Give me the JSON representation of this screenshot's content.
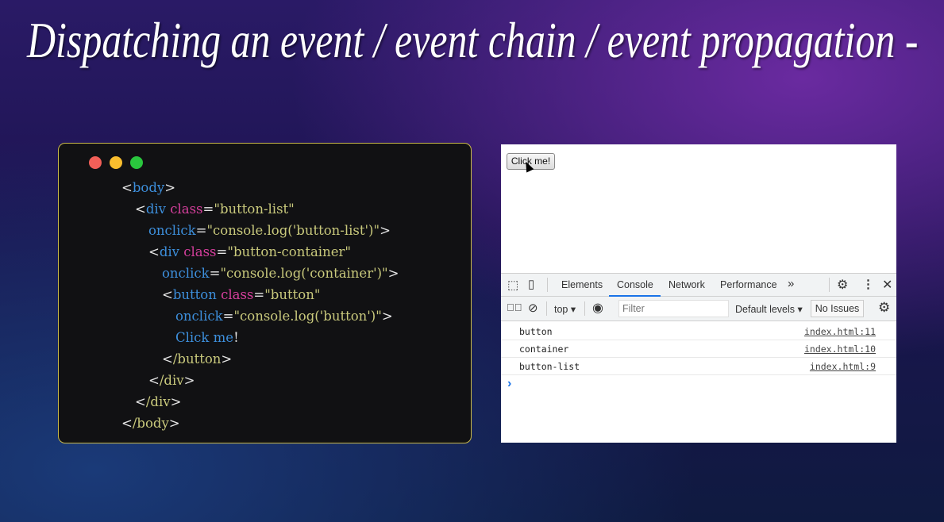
{
  "title": "Dispatching an event / event chain / event propagation -",
  "code": {
    "lines": [
      {
        "indent": 0,
        "tokens": [
          [
            "<",
            "p"
          ],
          [
            "body",
            "tag"
          ],
          [
            ">",
            "p"
          ]
        ]
      },
      {
        "indent": 1,
        "tokens": [
          [
            "<",
            "p"
          ],
          [
            "div ",
            "tag"
          ],
          [
            "class",
            "attr"
          ],
          [
            "=",
            "p"
          ],
          [
            "\"button-list\"",
            "str"
          ]
        ]
      },
      {
        "indent": 2,
        "tokens": [
          [
            "onclick",
            "tag"
          ],
          [
            "=",
            "p"
          ],
          [
            "\"console.log('button-list')\"",
            "str"
          ],
          [
            ">",
            "p"
          ]
        ]
      },
      {
        "indent": 2,
        "tokens": [
          [
            "<",
            "p"
          ],
          [
            "div ",
            "tag"
          ],
          [
            "class",
            "attr"
          ],
          [
            "=",
            "p"
          ],
          [
            "\"button-container\"",
            "str"
          ]
        ]
      },
      {
        "indent": 3,
        "tokens": [
          [
            "onclick",
            "tag"
          ],
          [
            "=",
            "p"
          ],
          [
            "\"console.log('container')\"",
            "str"
          ],
          [
            ">",
            "p"
          ]
        ]
      },
      {
        "indent": 3,
        "tokens": [
          [
            "<",
            "p"
          ],
          [
            "button ",
            "tag"
          ],
          [
            "class",
            "attr"
          ],
          [
            "=",
            "p"
          ],
          [
            "\"button\"",
            "str"
          ]
        ]
      },
      {
        "indent": 4,
        "tokens": [
          [
            "onclick",
            "tag"
          ],
          [
            "=",
            "p"
          ],
          [
            "\"console.log('button')\"",
            "str"
          ],
          [
            ">",
            "p"
          ]
        ]
      },
      {
        "indent": 4,
        "tokens": [
          [
            "Click me",
            "tag"
          ],
          [
            "!",
            "p"
          ]
        ]
      },
      {
        "indent": 3,
        "tokens": [
          [
            "<",
            "p"
          ],
          [
            "/button",
            "ctag"
          ],
          [
            ">",
            "p"
          ]
        ]
      },
      {
        "indent": 2,
        "tokens": [
          [
            "<",
            "p"
          ],
          [
            "/div",
            "ctag"
          ],
          [
            ">",
            "p"
          ]
        ]
      },
      {
        "indent": 1,
        "tokens": [
          [
            "<",
            "p"
          ],
          [
            "/div",
            "ctag"
          ],
          [
            ">",
            "p"
          ]
        ]
      },
      {
        "indent": 0,
        "tokens": [
          [
            "<",
            "p"
          ],
          [
            "/body",
            "ctag"
          ],
          [
            ">",
            "p"
          ]
        ]
      }
    ]
  },
  "browser": {
    "button_label": "Click me!"
  },
  "devtools": {
    "tabs": [
      "Elements",
      "Console",
      "Network",
      "Performance"
    ],
    "more": "»",
    "context": "top ▾",
    "filter_placeholder": "Filter",
    "levels": "Default levels ▾",
    "issues": "No Issues",
    "prompt": "›",
    "logs": [
      {
        "message": "button",
        "source": "index.html:11"
      },
      {
        "message": "container",
        "source": "index.html:10"
      },
      {
        "message": "button-list",
        "source": "index.html:9"
      }
    ]
  },
  "colors": {
    "accent": "#1a73e8",
    "border": "#c9b94a"
  }
}
